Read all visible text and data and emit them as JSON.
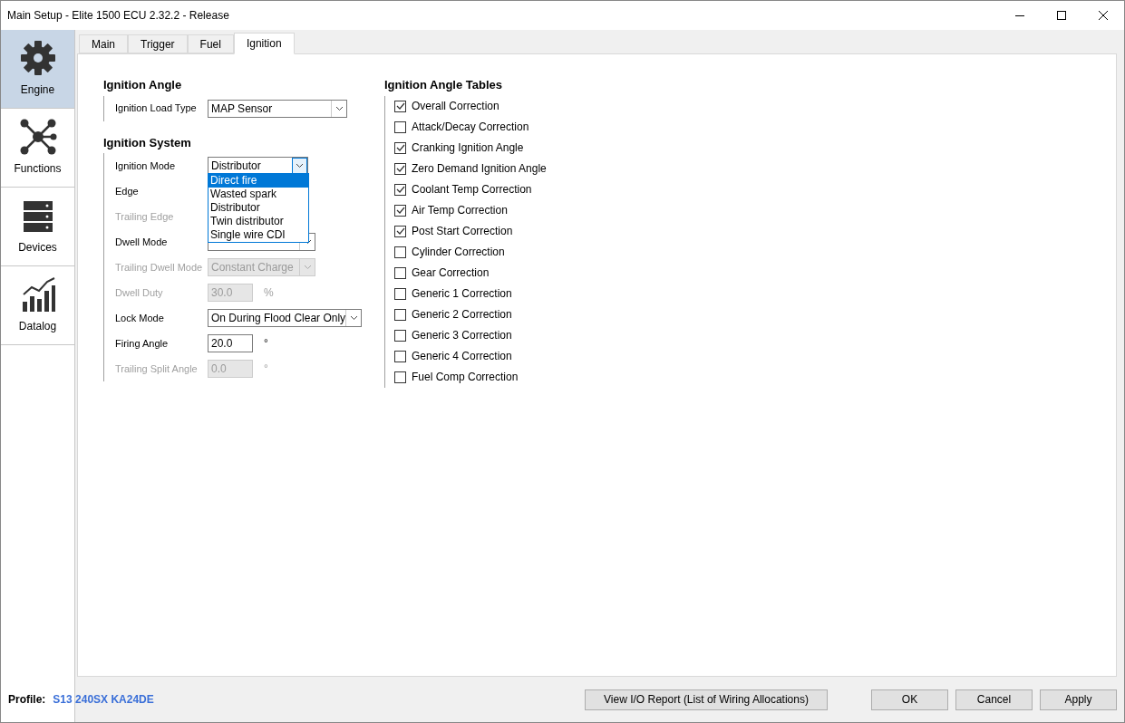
{
  "window": {
    "title": "Main Setup - Elite 1500 ECU 2.32.2 - Release"
  },
  "sidebar": {
    "items": [
      {
        "label": "Engine",
        "selected": true
      },
      {
        "label": "Functions",
        "selected": false
      },
      {
        "label": "Devices",
        "selected": false
      },
      {
        "label": "Datalog",
        "selected": false
      }
    ]
  },
  "tabs": [
    {
      "label": "Main",
      "selected": false
    },
    {
      "label": "Trigger",
      "selected": false
    },
    {
      "label": "Fuel",
      "selected": false
    },
    {
      "label": "Ignition",
      "selected": true
    }
  ],
  "ignition_angle": {
    "heading": "Ignition Angle",
    "rows": [
      {
        "label": "Ignition Load Type",
        "kind": "combo",
        "value": "MAP Sensor",
        "disabled": false
      }
    ]
  },
  "ignition_system": {
    "heading": "Ignition System",
    "rows": [
      {
        "label": "Ignition Mode",
        "kind": "combo",
        "value": "Distributor",
        "disabled": false,
        "open": true
      },
      {
        "label": "Edge",
        "kind": "hidden",
        "disabled": false
      },
      {
        "label": "Trailing Edge",
        "kind": "hidden",
        "disabled": true
      },
      {
        "label": "Dwell Mode",
        "kind": "combo",
        "disabled": false
      },
      {
        "label": "Trailing Dwell Mode",
        "kind": "combo",
        "value": "Constant Charge",
        "disabled": true
      },
      {
        "label": "Dwell Duty",
        "kind": "number",
        "value": "30.0",
        "unit": "%",
        "disabled": true
      },
      {
        "label": "Lock Mode",
        "kind": "combo",
        "value": "On During Flood Clear Only",
        "disabled": false
      },
      {
        "label": "Firing Angle",
        "kind": "number",
        "value": "20.0",
        "unit": "°",
        "disabled": false
      },
      {
        "label": "Trailing Split Angle",
        "kind": "number",
        "value": "0.0",
        "unit": "°",
        "disabled": true
      }
    ],
    "dropdown": [
      {
        "label": "Direct fire",
        "selected": true
      },
      {
        "label": "Wasted spark",
        "selected": false
      },
      {
        "label": "Distributor",
        "selected": false
      },
      {
        "label": "Twin distributor",
        "selected": false
      },
      {
        "label": "Single wire CDI",
        "selected": false
      }
    ]
  },
  "tables": {
    "heading": "Ignition Angle Tables",
    "items": [
      {
        "label": "Overall Correction",
        "checked": true
      },
      {
        "label": "Attack/Decay Correction",
        "checked": false
      },
      {
        "label": "Cranking Ignition Angle",
        "checked": true
      },
      {
        "label": "Zero Demand Ignition Angle",
        "checked": true
      },
      {
        "label": "Coolant Temp Correction",
        "checked": true
      },
      {
        "label": "Air Temp Correction",
        "checked": true
      },
      {
        "label": "Post Start Correction",
        "checked": true
      },
      {
        "label": "Cylinder Correction",
        "checked": false
      },
      {
        "label": "Gear Correction",
        "checked": false
      },
      {
        "label": "Generic 1 Correction",
        "checked": false
      },
      {
        "label": "Generic 2 Correction",
        "checked": false
      },
      {
        "label": "Generic 3 Correction",
        "checked": false
      },
      {
        "label": "Generic 4 Correction",
        "checked": false
      },
      {
        "label": "Fuel Comp Correction",
        "checked": false
      }
    ]
  },
  "footer": {
    "profile_label": "Profile:",
    "profile_value": "S13 240SX KA24DE",
    "report_button": "View I/O Report (List of Wiring Allocations)",
    "buttons": [
      "OK",
      "Cancel",
      "Apply"
    ]
  }
}
